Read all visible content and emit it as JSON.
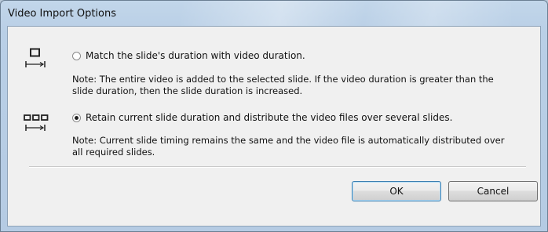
{
  "dialog": {
    "title": "Video Import Options"
  },
  "options": [
    {
      "icon": "single-slide-duration-icon",
      "selected": false,
      "label": "Match the slide's duration with video duration.",
      "note_lines": [
        "Note: The entire video is added to the selected slide. If the video duration is greater than the",
        "slide duration, then the slide duration is increased."
      ]
    },
    {
      "icon": "multiple-slides-duration-icon",
      "selected": true,
      "label": "Retain current slide duration and distribute the video files over several slides.",
      "note_lines": [
        "Note: Current slide timing remains the same and the video file is automatically distributed over",
        "all required slides."
      ]
    }
  ],
  "buttons": {
    "ok": "OK",
    "cancel": "Cancel"
  }
}
